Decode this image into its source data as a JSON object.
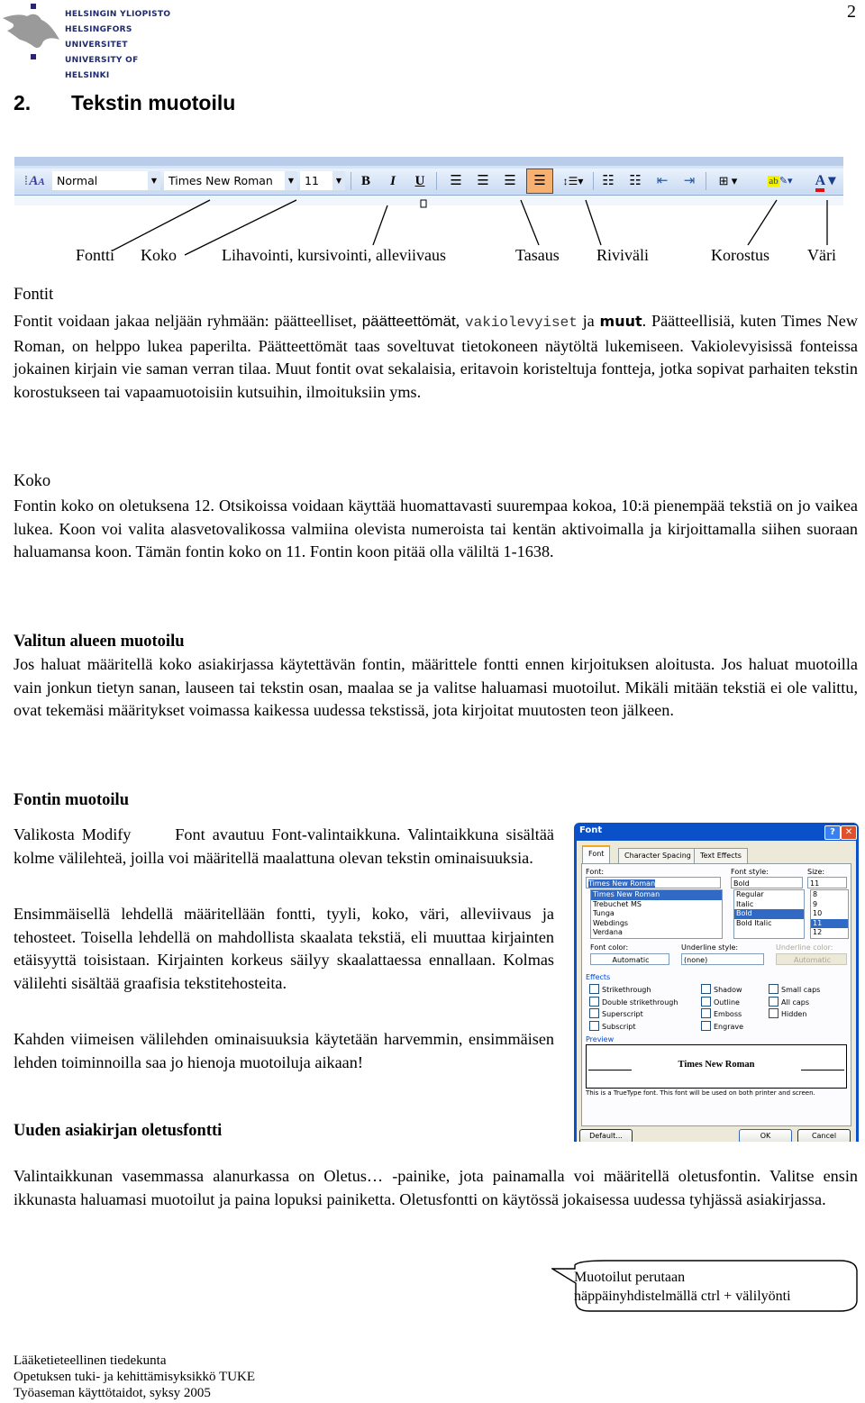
{
  "header": {
    "logo_lines": [
      "HELSINGIN YLIOPISTO",
      "HELSINGFORS UNIVERSITET",
      "UNIVERSITY OF HELSINKI"
    ],
    "page_number": "2",
    "chapter_number": "2.",
    "chapter_title": "Tekstin muotoilu"
  },
  "toolbar": {
    "style_value": "Normal",
    "font_value": "Times New Roman",
    "size_value": "11",
    "bold": "B",
    "italic": "I",
    "underline": "U",
    "highlight_color": "#f0f000",
    "font_color": "#e01010",
    "active_button_color": "#f8b070"
  },
  "labels": [
    "Fontti",
    "Koko",
    "Lihavointi, kursivointi, alleviivaus",
    "Tasaus",
    "Riviväli",
    "Korostus",
    "Väri"
  ],
  "sections": {
    "fontit": {
      "heading": "Fontit",
      "p1_a": "Fontit voidaan jakaa neljään ryhmään: päätteelliset, ",
      "p1_sans": "päätteettömät",
      "p1_b": ", ",
      "p1_mono": "vakiolevyiset",
      "p1_c": " ja ",
      "p1_decor": "muut",
      "p1_d": ". Päätteellisiä, kuten Times New Roman, on helppo lukea paperilta. Päätteettömät taas soveltuvat tietokoneen näytöltä lukemiseen. Vakiolevyisissä fonteissa jokainen kirjain vie saman verran tilaa. Muut fontit ovat sekalaisia, eritavoin koristeltuja fontteja, jotka sopivat parhaiten tekstin korostukseen tai vapaamuotoisiin kutsuihin, ilmoituksiin yms."
    },
    "koko": {
      "heading": "Koko",
      "text": "Fontin koko on oletuksena 12. Otsikoissa voidaan käyttää huomattavasti suurempaa kokoa, 10:ä pienempää tekstiä on jo vaikea lukea. Koon voi valita alasvetovalikossa valmiina olevista numeroista tai kentän aktivoimalla ja kirjoittamalla siihen suoraan haluamansa koon. Tämän fontin koko on 11. Fontin koon pitää olla väliltä 1-1638."
    },
    "valitun": {
      "heading": "Valitun alueen muotoilu",
      "text": "Jos haluat määritellä koko asiakirjassa käytettävän fontin, määrittele fontti ennen kirjoituksen aloitusta. Jos haluat muotoilla vain jonkun tietyn sanan, lauseen tai tekstin osan, maalaa se ja valitse haluamasi muotoilut. Mikäli mitään tekstiä ei ole valittu, ovat tekemäsi määritykset voimassa kaikessa uudessa tekstissä, jota kirjoitat muutosten teon jälkeen."
    },
    "fontin_muotoilu": {
      "heading": "Fontin muotoilu",
      "p1": "Valikosta Modify      Font avautuu Font-valintaikkuna. Valintaikkuna sisältää kolme välilehteä, joilla voi määritellä maalattuna olevan tekstin ominaisuuksia.",
      "p2": "Ensimmäisellä lehdellä määritellään fontti, tyyli, koko, väri, alleviivaus ja tehosteet. Toisella lehdellä on mahdollista skaalata tekstiä, eli muuttaa kirjainten etäisyyttä toisistaan. Kirjainten korkeus säilyy skaalattaessa ennallaan. Kolmas välilehti sisältää graafisia tekstitehosteita.",
      "p3": "Kahden viimeisen välilehden ominaisuuksia käytetään harvemmin, ensimmäisen lehden toiminnoilla saa jo hienoja muotoiluja aikaan!"
    },
    "oletusfontti": {
      "heading": "Uuden asiakirjan oletusfontti",
      "text": "Valintaikkunan vasemmassa alanurkassa on Oletus… -painike, jota painamalla voi määritellä oletusfontin. Valitse ensin ikkunasta haluamasi muotoilut ja paina lopuksi painiketta. Oletusfontti on käytössä jokaisessa uudessa tyhjässä asiakirjassa."
    }
  },
  "dialog": {
    "title": "Font",
    "help": "?",
    "close": "✕",
    "tabs": [
      "Font",
      "Character Spacing",
      "Text Effects"
    ],
    "font_label": "Font:",
    "font_value": "Times New Roman",
    "font_list": [
      "Times New Roman",
      "Trebuchet MS",
      "Tunga",
      "Webdings",
      "Verdana"
    ],
    "style_label": "Font style:",
    "style_value": "Bold",
    "style_list": [
      "Regular",
      "Italic",
      "Bold",
      "Bold Italic"
    ],
    "size_label": "Size:",
    "size_value": "11",
    "size_list": [
      "8",
      "9",
      "10",
      "11",
      "12"
    ],
    "font_color_label": "Font color:",
    "font_color_value": "Automatic",
    "underline_style_label": "Underline style:",
    "underline_style_value": "(none)",
    "underline_color_label": "Underline color:",
    "underline_color_value": "Automatic",
    "effects_label": "Effects",
    "effects_col1": [
      "Strikethrough",
      "Double strikethrough",
      "Superscript",
      "Subscript"
    ],
    "effects_col2": [
      "Shadow",
      "Outline",
      "Emboss",
      "Engrave"
    ],
    "effects_col3": [
      "Small caps",
      "All caps",
      "Hidden"
    ],
    "preview_label": "Preview",
    "preview_text": "Times New Roman",
    "info": "This is a TrueType font. This font will be used on both printer and screen.",
    "default_button": "Default...",
    "ok_button": "OK",
    "cancel_button": "Cancel"
  },
  "callout": {
    "line1": "Muotoilut perutaan",
    "line2": "näppäinyhdistelmällä ctrl + välilyönti"
  },
  "footer": {
    "line1": "Lääketieteellinen tiedekunta",
    "line2": "Opetuksen tuki- ja kehittämisyksikkö TUKE",
    "line3": "Työaseman käyttötaidot, syksy 2005"
  }
}
